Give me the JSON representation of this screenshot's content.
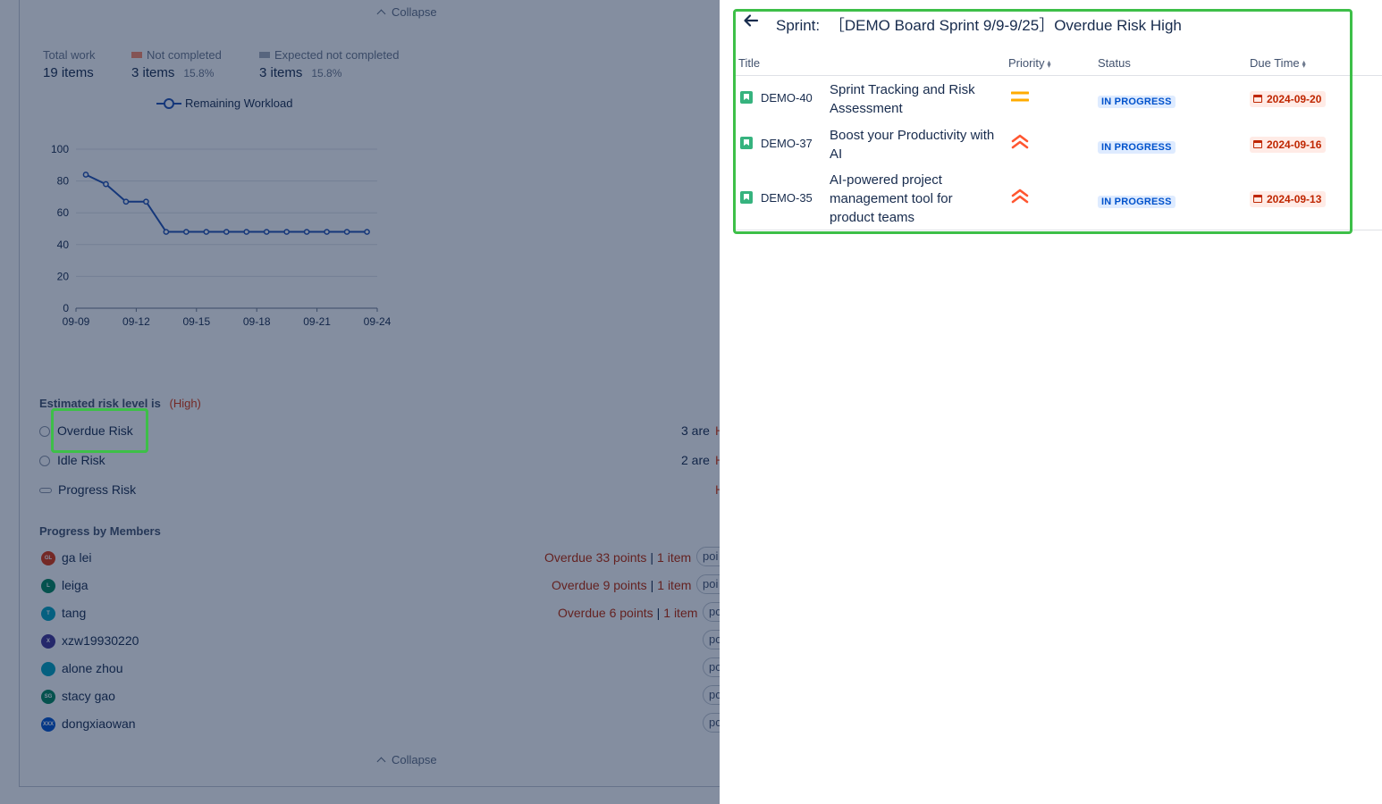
{
  "background": {
    "collapse_label": "Collapse",
    "stats": {
      "total_work": {
        "label": "Total work",
        "value": "19 items"
      },
      "not_completed": {
        "label": "Not completed",
        "value": "3 items",
        "pct": "15.8%",
        "color": "#ff8b66"
      },
      "expected_not_completed": {
        "label": "Expected not completed",
        "value": "3 items",
        "pct": "15.8%",
        "color": "#a5adba"
      }
    },
    "chart_data": {
      "type": "line",
      "series": [
        {
          "name": "Remaining Workload",
          "values": [
            84,
            78,
            67,
            67,
            48,
            48,
            48,
            48,
            48,
            48,
            48,
            48,
            48,
            48,
            48
          ]
        }
      ],
      "x": [
        "09-09",
        "09-10",
        "09-11",
        "09-12",
        "09-13",
        "09-14",
        "09-15",
        "09-16",
        "09-17",
        "09-18",
        "09-19",
        "09-20",
        "09-21",
        "09-22",
        "09-23"
      ],
      "xticks": [
        "09-09",
        "09-12",
        "09-15",
        "09-18",
        "09-21",
        "09-24"
      ],
      "yticks": [
        "0",
        "20",
        "40",
        "60",
        "80",
        "100"
      ],
      "ylim": [
        0,
        100
      ],
      "grid": true,
      "legend": "top-center",
      "line_color": "#2151b3"
    },
    "risk": {
      "heading": "Estimated risk level is",
      "level": "(High)",
      "items": [
        {
          "label": "Overdue Risk",
          "count": "3 are",
          "tail": "H"
        },
        {
          "label": "Idle Risk",
          "count": "2 are",
          "tail": "H"
        },
        {
          "label": "Progress Risk",
          "count": "",
          "tail": "H"
        }
      ]
    },
    "members": {
      "heading": "Progress by Members",
      "items": [
        {
          "name": "ga lei",
          "initials": "GL",
          "color": "#de350b",
          "overdue": "Overdue 33 points",
          "items": "1 item",
          "pill": "poi"
        },
        {
          "name": "leiga",
          "initials": "L",
          "color": "#00875a",
          "overdue": "Overdue 9 points",
          "items": "1 item",
          "pill": "poi"
        },
        {
          "name": "tang",
          "initials": "T",
          "color": "#00a3bf",
          "overdue": "Overdue 6 points",
          "items": "1 item",
          "pill": "pc"
        },
        {
          "name": "xzw19930220",
          "initials": "X",
          "color": "#403294",
          "overdue": "",
          "items": "",
          "pill": "pc"
        },
        {
          "name": "alone zhou",
          "initials": "",
          "color": "#00a3bf",
          "overdue": "",
          "items": "",
          "pill": "pc"
        },
        {
          "name": "stacy gao",
          "initials": "SG",
          "color": "#00875a",
          "overdue": "",
          "items": "",
          "pill": "pc"
        },
        {
          "name": "dongxiaowan",
          "initials": "XXX",
          "color": "#0052cc",
          "overdue": "",
          "items": "",
          "pill": "pc"
        }
      ]
    }
  },
  "panel": {
    "title_prefix": "Sprint:",
    "title": "［DEMO Board Sprint 9/9-9/25］Overdue Risk High",
    "columns": {
      "title": "Title",
      "priority": "Priority",
      "status": "Status",
      "due": "Due Time"
    },
    "rows": [
      {
        "key": "DEMO-40",
        "title_line1": "Sprint Tracking and Risk",
        "title_line2": "Assessment",
        "title_line3": "",
        "priority": "medium",
        "status": "IN PROGRESS",
        "due": "2024-09-20"
      },
      {
        "key": "DEMO-37",
        "title_line1": "Boost your Productivity with",
        "title_line2": "AI",
        "title_line3": "",
        "priority": "highest",
        "status": "IN PROGRESS",
        "due": "2024-09-16"
      },
      {
        "key": "DEMO-35",
        "title_line1": "AI-powered project",
        "title_line2": "management tool for",
        "title_line3": "product teams",
        "priority": "highest",
        "status": "IN PROGRESS",
        "due": "2024-09-13"
      }
    ]
  },
  "colors": {
    "highlight": "#3dbf48",
    "overlay": "#091e42",
    "priority_medium": "#ffab00",
    "priority_highest": "#ff5630"
  }
}
